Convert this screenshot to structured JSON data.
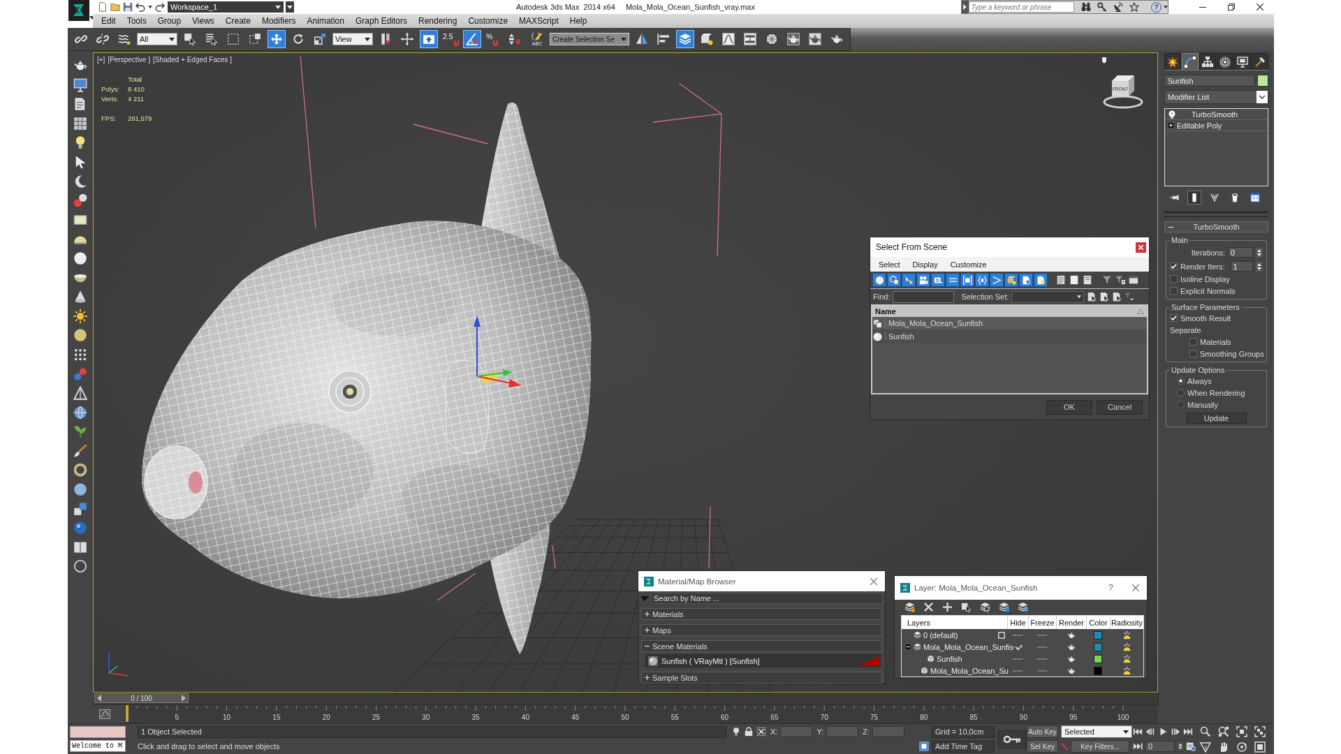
{
  "title_bar": {
    "workspace": "Workspace_1",
    "app_title": "Autodesk 3ds Max  2014 x64",
    "file_name": "Mola_Mola_Ocean_Sunfish_vray.max",
    "search": {
      "placeholder": "Type a keyword or phrase"
    },
    "help": "?"
  },
  "menu_bar": [
    "Edit",
    "Tools",
    "Group",
    "Views",
    "Create",
    "Modifiers",
    "Animation",
    "Graph Editors",
    "Rendering",
    "Customize",
    "MAXScript",
    "Help"
  ],
  "main_toolbar": [
    {
      "kind": "link",
      "active": false
    },
    {
      "kind": "unlink",
      "active": false
    },
    {
      "kind": "bind",
      "active": false
    },
    {
      "kind": "dropdown",
      "value": "All"
    },
    {
      "kind": "select",
      "active": false
    },
    {
      "kind": "select_by_name",
      "active": false
    },
    {
      "kind": "region",
      "active": false
    },
    {
      "kind": "crossing",
      "active": false
    },
    {
      "kind": "move",
      "active": true
    },
    {
      "kind": "rotate",
      "active": false
    },
    {
      "kind": "scale",
      "active": false
    },
    {
      "kind": "dropdown",
      "value": "View"
    },
    {
      "kind": "pivot",
      "active": false
    },
    {
      "kind": "manipulate",
      "active": false
    },
    {
      "kind": "keyboard",
      "active": true
    },
    {
      "kind": "snap",
      "label": "2.5",
      "active": false
    },
    {
      "kind": "angle_snap",
      "active": true
    },
    {
      "kind": "percent_snap",
      "label": "%",
      "active": false
    },
    {
      "kind": "spinner_snap",
      "active": false
    },
    {
      "kind": "named_sel",
      "label": "ABC",
      "active": false
    },
    {
      "kind": "combo",
      "value": "Create Selection Se"
    },
    {
      "kind": "mirror",
      "active": false
    },
    {
      "kind": "align",
      "active": false
    },
    {
      "kind": "layers",
      "active": true
    },
    {
      "kind": "scene_explorer",
      "active": false
    },
    {
      "kind": "curve",
      "active": false
    },
    {
      "kind": "schematic",
      "active": false
    },
    {
      "kind": "material",
      "active": false
    },
    {
      "kind": "render_setup",
      "active": false
    },
    {
      "kind": "frame_window",
      "active": false
    },
    {
      "kind": "render",
      "active": false
    }
  ],
  "viewport": {
    "labels": [
      "[+]",
      "[Perspective ]",
      "[Shaded + Edged Faces ]"
    ],
    "stats": {
      "heading": "Total",
      "rows": [
        {
          "label": "Polys:",
          "value": "8 410"
        },
        {
          "label": "Verts:",
          "value": "4 211"
        }
      ]
    },
    "fps": {
      "label": "FPS:",
      "value": "291,579"
    },
    "view_cube": {
      "face": "FRONT"
    }
  },
  "command_panel": {
    "tabs": [
      {
        "kind": "create",
        "selected": false
      },
      {
        "kind": "modify",
        "selected": true
      },
      {
        "kind": "hierarchy",
        "selected": false
      },
      {
        "kind": "motion",
        "selected": false
      },
      {
        "kind": "display",
        "selected": false
      },
      {
        "kind": "utilities",
        "selected": false
      }
    ],
    "object_name": "Sunfish",
    "modifier_list": "Modifier List",
    "stack": [
      {
        "kind": "modifier",
        "name": "TurboSmooth"
      },
      {
        "kind": "object",
        "name": "Editable Poly",
        "expanded": false
      }
    ],
    "stack_tools": [
      {
        "kind": "pin",
        "active": false
      },
      {
        "kind": "end_result",
        "active": true
      },
      {
        "kind": "unique",
        "active": false
      },
      {
        "kind": "remove",
        "active": false
      },
      {
        "kind": "configure",
        "active": false
      }
    ],
    "rollout": {
      "title": "TurboSmooth",
      "expanded": true,
      "groups": [
        {
          "title": "Main",
          "items": [
            {
              "kind": "spinner",
              "label": "Iterations:",
              "value": "0"
            },
            {
              "kind": "check_spinner",
              "label": "Render Iters:",
              "value": "1",
              "checked": true
            },
            {
              "kind": "checkbox",
              "label": "Isoline Display",
              "checked": false
            },
            {
              "kind": "checkbox",
              "label": "Explicit Normals",
              "checked": false
            }
          ]
        },
        {
          "title": "Surface Parameters",
          "items": [
            {
              "kind": "checkbox",
              "label": "Smooth Result",
              "checked": true
            },
            {
              "kind": "label",
              "label": "Separate",
              "children": [
                {
                  "kind": "checkbox",
                  "label": "Materials",
                  "checked": false
                },
                {
                  "kind": "checkbox",
                  "label": "Smoothing Groups",
                  "checked": false
                }
              ]
            }
          ]
        },
        {
          "title": "Update Options",
          "items": [
            {
              "kind": "radio",
              "label": "Always",
              "selected": true
            },
            {
              "kind": "radio",
              "label": "When Rendering",
              "selected": false
            },
            {
              "kind": "radio",
              "label": "Manually",
              "selected": false
            },
            {
              "kind": "button",
              "label": "Update"
            }
          ]
        }
      ]
    }
  },
  "select_from_scene": {
    "title": "Select From Scene",
    "menu": [
      "Select",
      "Display",
      "Customize"
    ],
    "filters": [
      {
        "kind": "geometry",
        "active": true
      },
      {
        "kind": "shapes",
        "active": true
      },
      {
        "kind": "lights",
        "active": true
      },
      {
        "kind": "cameras",
        "active": true
      },
      {
        "kind": "helpers",
        "active": true
      },
      {
        "kind": "space_warps",
        "active": true
      },
      {
        "kind": "groups",
        "active": true
      },
      {
        "kind": "xrefs",
        "active": true
      },
      {
        "kind": "bones",
        "active": true
      },
      {
        "kind": "containers",
        "active": true
      },
      {
        "kind": "frozen",
        "active": true
      },
      {
        "kind": "hidden",
        "active": true
      }
    ],
    "find_label": "Find:",
    "selection_set_label": "Selection Set:",
    "columns": [
      "Name"
    ],
    "rows": [
      {
        "kind": "group",
        "name": "Mola_Mola_Ocean_Sunfish",
        "selected": false
      },
      {
        "kind": "geometry",
        "name": "Sunfish",
        "selected": false
      }
    ],
    "buttons": [
      "OK",
      "Cancel"
    ]
  },
  "material_browser": {
    "title": "Material/Map Browser",
    "search": {
      "placeholder": "Search by Name ..."
    },
    "sections": [
      {
        "title": "Materials",
        "expanded": false
      },
      {
        "title": "Maps",
        "expanded": false
      },
      {
        "title": "Scene Materials",
        "expanded": true,
        "items": [
          "Sunfish ( VRayMtl ) [Sunfish]"
        ]
      },
      {
        "title": "Sample Slots",
        "expanded": false
      }
    ]
  },
  "layer_dialog": {
    "title": "Layer: Mola_Mola_Ocean_Sunfish",
    "help": "?",
    "columns": [
      "Layers",
      "Hide",
      "Freeze",
      "Render",
      "Color",
      "Radiosity"
    ],
    "rows": [
      {
        "kind": "layer",
        "name": "0 (default)",
        "current": false,
        "hidden": false,
        "frozen": false,
        "color": "#1e8fb4"
      },
      {
        "kind": "layer",
        "name": "Mola_Mola_Ocean_Sunfis",
        "current": true,
        "expanded": true,
        "hidden": false,
        "frozen": false,
        "color": "#1e8fb4",
        "children": [
          {
            "kind": "object",
            "name": "Sunfish",
            "hidden": false,
            "frozen": false,
            "color": "#7ed350"
          },
          {
            "kind": "object",
            "name": "Mola_Mola_Ocean_Su",
            "hidden": false,
            "frozen": false,
            "color": "#000000"
          }
        ]
      }
    ]
  },
  "time_slider": {
    "label": "0 / 100",
    "level": 0
  },
  "track_bar": {
    "ticks": [
      "5",
      "10",
      "15",
      "20",
      "25",
      "30",
      "35",
      "40",
      "45",
      "50",
      "55",
      "60",
      "65",
      "70",
      "75",
      "80",
      "85",
      "90",
      "95",
      "100"
    ]
  },
  "status_bar": {
    "listener_output": "Welcome to M",
    "selection": "1 Object Selected",
    "prompt": "Click and drag to select and move objects",
    "coordinates": [
      "X:",
      "Y:",
      "Z:"
    ],
    "grid": "Grid = 10,0cm",
    "time_tag": "Add Time Tag",
    "auto_key": {
      "label": "Auto Key",
      "active": false
    },
    "key_mode": "Selected",
    "set_key": "Set Key",
    "key_filters": "Key Filters...",
    "frame": "0"
  }
}
